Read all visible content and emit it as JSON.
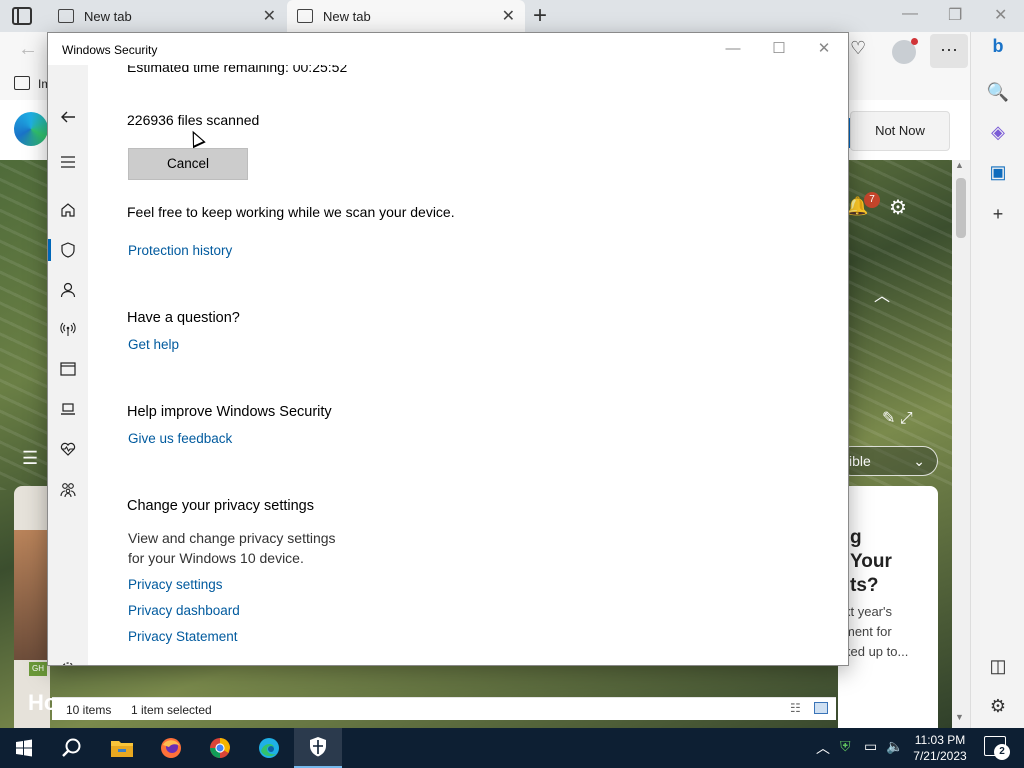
{
  "browser": {
    "tabs": [
      {
        "label": "New tab"
      },
      {
        "label": "New tab"
      }
    ],
    "favorites_label": "Im",
    "banner": {
      "not_now_label": "Not Now"
    },
    "ntp": {
      "notification_count": "7",
      "visible_pill_label": "ible",
      "card_headline_lines": [
        "g",
        "Your",
        "ts?"
      ],
      "card_text_lines": [
        "xt year's",
        "ment for",
        "ked up to..."
      ],
      "left_card_badge": "GH",
      "left_card_text": "Ho"
    }
  },
  "explorer_status": {
    "items_count": "10 items",
    "selection": "1 item selected"
  },
  "security": {
    "window_title": "Windows Security",
    "scan": {
      "time_remaining": "Estimated time remaining: 00:25:52",
      "files_scanned": "226936  files scanned",
      "cancel_label": "Cancel",
      "keep_working": "Feel free to keep working while we scan your device.",
      "protection_history_link": "Protection history"
    },
    "question": {
      "heading": "Have a question?",
      "help_link": "Get help"
    },
    "improve": {
      "heading": "Help improve Windows Security",
      "feedback_link": "Give us feedback"
    },
    "privacy": {
      "heading": "Change your privacy settings",
      "description_line1": "View and change privacy settings",
      "description_line2": "for your Windows 10 device.",
      "settings_link": "Privacy settings",
      "dashboard_link": "Privacy dashboard",
      "statement_link": "Privacy Statement"
    },
    "nav_icons": [
      "back-icon",
      "menu-icon",
      "home-icon",
      "shield-icon",
      "account-icon",
      "firewall-icon",
      "app-browser-icon",
      "device-security-icon",
      "health-icon",
      "family-icon",
      "settings-icon"
    ],
    "active_nav": "shield-icon",
    "accent_color": "#0067b8",
    "link_color": "#005a9e"
  },
  "taskbar": {
    "time": "11:03 PM",
    "date": "7/21/2023",
    "notification_count": "2",
    "apps": [
      "file-explorer-icon",
      "firefox-icon",
      "chrome-icon",
      "edge-icon",
      "windows-security-icon"
    ]
  }
}
